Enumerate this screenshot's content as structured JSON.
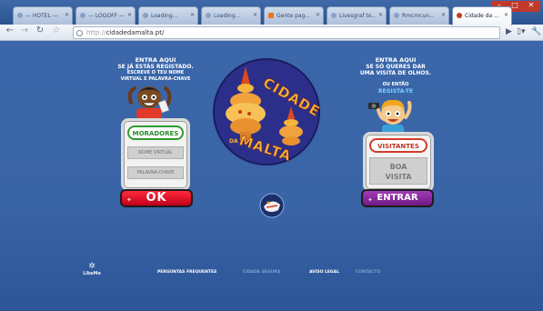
{
  "browser": {
    "tabs": [
      {
        "label": "— HOTEL —",
        "favicon": "page-icon"
      },
      {
        "label": "— LOGOFF —",
        "favicon": "page-icon"
      },
      {
        "label": "Loading...",
        "favicon": "page-icon"
      },
      {
        "label": "Loading...",
        "favicon": "page-icon"
      },
      {
        "label": "Gente pag...",
        "favicon": "blogger-icon"
      },
      {
        "label": "Livesgraf to...",
        "favicon": "page-icon"
      },
      {
        "label": "Rmcmcun...",
        "favicon": "page-icon"
      },
      {
        "label": "Cidade da ...",
        "favicon": "page-icon"
      }
    ],
    "url_prefix": "http://",
    "url": "cidadedamalta.pt/"
  },
  "page": {
    "left_intro": [
      "ENTRA AQUI",
      "SE JÁ ESTÁS REGISTADO.",
      "ESCREVE O TEU NOME",
      "VIRTUAL E PALAVRA-CHAVE"
    ],
    "right_intro": [
      "ENTRA AQUI",
      "SE SÓ QUERES DAR",
      "UMA VISITA DE OLHOS."
    ],
    "right_alt_intro": "OU ENTÃO",
    "right_alt_link": "REGISTA-TE",
    "logo_text": {
      "line1": "CIDADE",
      "line2": "DA",
      "line3": "MALTA"
    },
    "moradores": {
      "title": "MORADORES",
      "name_placeholder": "NOME VIRTUAL",
      "password_placeholder": "PALAVRA-CHAVE",
      "button": "OK"
    },
    "visitantes": {
      "title": "VISITANTES",
      "message_line1": "BOA",
      "message_line2": "VISITA",
      "button": "ENTRAR"
    },
    "footer": {
      "brand": "LikeMe",
      "links": [
        "PERGUNTAS FREQUENTES",
        "CIDADE SEGURA",
        "AVISO LEGAL",
        "CONTACTO"
      ]
    }
  },
  "colors": {
    "page_bg": "#3964a6",
    "ok_button": "#d9001b",
    "entrar_button": "#8a2a9e",
    "moradores_accent": "#2f9a2f",
    "visitantes_accent": "#d43a2a"
  }
}
